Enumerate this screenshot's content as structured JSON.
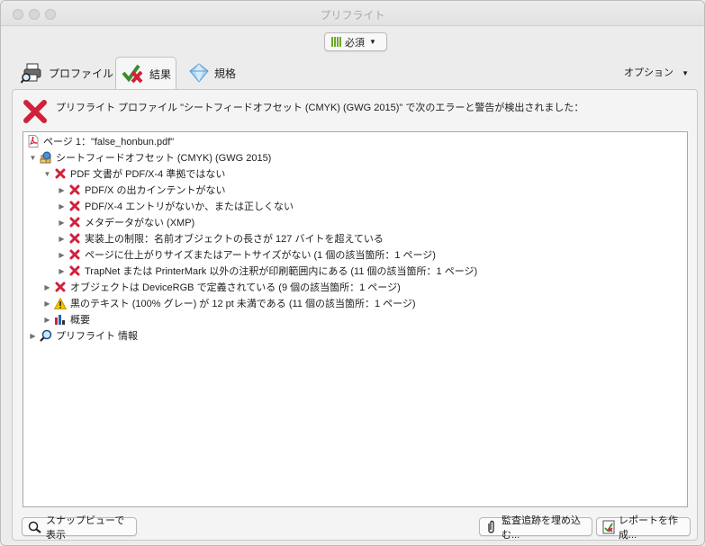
{
  "window": {
    "title": "プリフライト"
  },
  "filter": {
    "label": "必須"
  },
  "tabs": {
    "profile": "プロファイル",
    "results": "結果",
    "standards": "規格"
  },
  "options_label": "オプション",
  "header_message": "プリフライト プロファイル \"シートフィードオフセット (CMYK) (GWG 2015)\" で次のエラーと警告が検出されました：",
  "tree": {
    "page": "ページ 1：\"false_honbun.pdf\"",
    "profile": "シートフィードオフセット (CMYK) (GWG 2015)",
    "pdfx": "PDF 文書が PDF/X-4 準拠ではない",
    "pdfx_children": [
      "PDF/X の出カインテントがない",
      "PDF/X-4 エントリがないか、または正しくない",
      "メタデータがない (XMP)",
      "実装上の制限：名前オブジェクトの長さが 127 バイトを超えている",
      "ページに仕上がりサイズまたはアートサイズがない (1 個の該当箇所：1 ページ)",
      "TrapNet または PrinterMark 以外の注釈が印刷範囲内にある (11 個の該当箇所：1 ページ)"
    ],
    "devicergb": "オブジェクトは DeviceRGB で定義されている (9 個の該当箇所：1 ページ)",
    "black_text": "黒のテキスト (100% グレー) が 12 pt 未満である (11 個の該当箇所：1 ページ)",
    "overview": "概要",
    "preflight_info": "プリフライト 情報"
  },
  "buttons": {
    "snap": "スナップビューで表示",
    "audit": "監査追跡を埋め込む...",
    "report": "レポートを作成..."
  },
  "colors": {
    "error": "#d0213b",
    "warning": "#f5c400",
    "ok_bar": "#6ea82c"
  }
}
